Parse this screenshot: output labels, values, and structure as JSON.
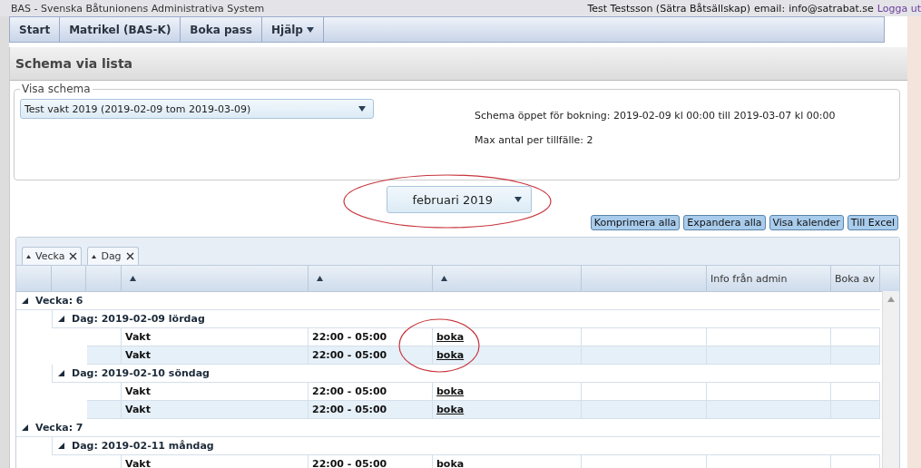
{
  "app_title": "BAS - Svenska Båtunionens Administrativa System",
  "user": {
    "name": "Test Testsson (Sätra Båtsällskap)",
    "email_label": "email:",
    "email": "info@satrabat.se",
    "logout": "Logga ut"
  },
  "menu": [
    {
      "label": "Start",
      "dropdown": false
    },
    {
      "label": "Matrikel (BAS-K)",
      "dropdown": false
    },
    {
      "label": "Boka pass",
      "dropdown": false
    },
    {
      "label": "Hjälp",
      "dropdown": true
    }
  ],
  "page_title": "Schema via lista",
  "schedule": {
    "legend": "Visa schema",
    "value": "Test vakt 2019 (2019-02-09 tom 2019-03-09)",
    "info": [
      "Schema öppet för bokning: 2019-02-09 kl 00:00 till 2019-03-07 kl 00:00",
      "Max antal per tillfälle: 2"
    ]
  },
  "month": "februari 2019",
  "actions": [
    "Komprimera alla",
    "Expandera alla",
    "Visa kalender",
    "Till Excel"
  ],
  "group_chips": [
    "Vecka",
    "Dag"
  ],
  "columns": [
    {
      "sorted": true
    },
    {
      "sorted": true
    },
    {
      "sorted": true
    },
    {
      "sorted": false
    },
    {
      "label": "Info från admin",
      "sorted": false
    },
    {
      "label": "Boka av",
      "sorted": false
    }
  ],
  "groups": [
    {
      "label": "Vecka: 6",
      "expanded": true,
      "children": [
        {
          "label": "Dag: 2019-02-09 lördag",
          "expanded": true,
          "rows": [
            {
              "name": "Vakt",
              "time": "22:00 - 05:00",
              "action": "boka"
            },
            {
              "name": "Vakt",
              "time": "22:00 - 05:00",
              "action": "boka"
            }
          ]
        },
        {
          "label": "Dag: 2019-02-10 söndag",
          "expanded": true,
          "rows": [
            {
              "name": "Vakt",
              "time": "22:00 - 05:00",
              "action": "boka"
            },
            {
              "name": "Vakt",
              "time": "22:00 - 05:00",
              "action": "boka"
            }
          ]
        }
      ]
    },
    {
      "label": "Vecka: 7",
      "expanded": true,
      "children": [
        {
          "label": "Dag: 2019-02-11 måndag",
          "expanded": true,
          "rows": [
            {
              "name": "Vakt",
              "time": "22:00 - 05:00",
              "action": "boka"
            }
          ]
        }
      ]
    }
  ]
}
